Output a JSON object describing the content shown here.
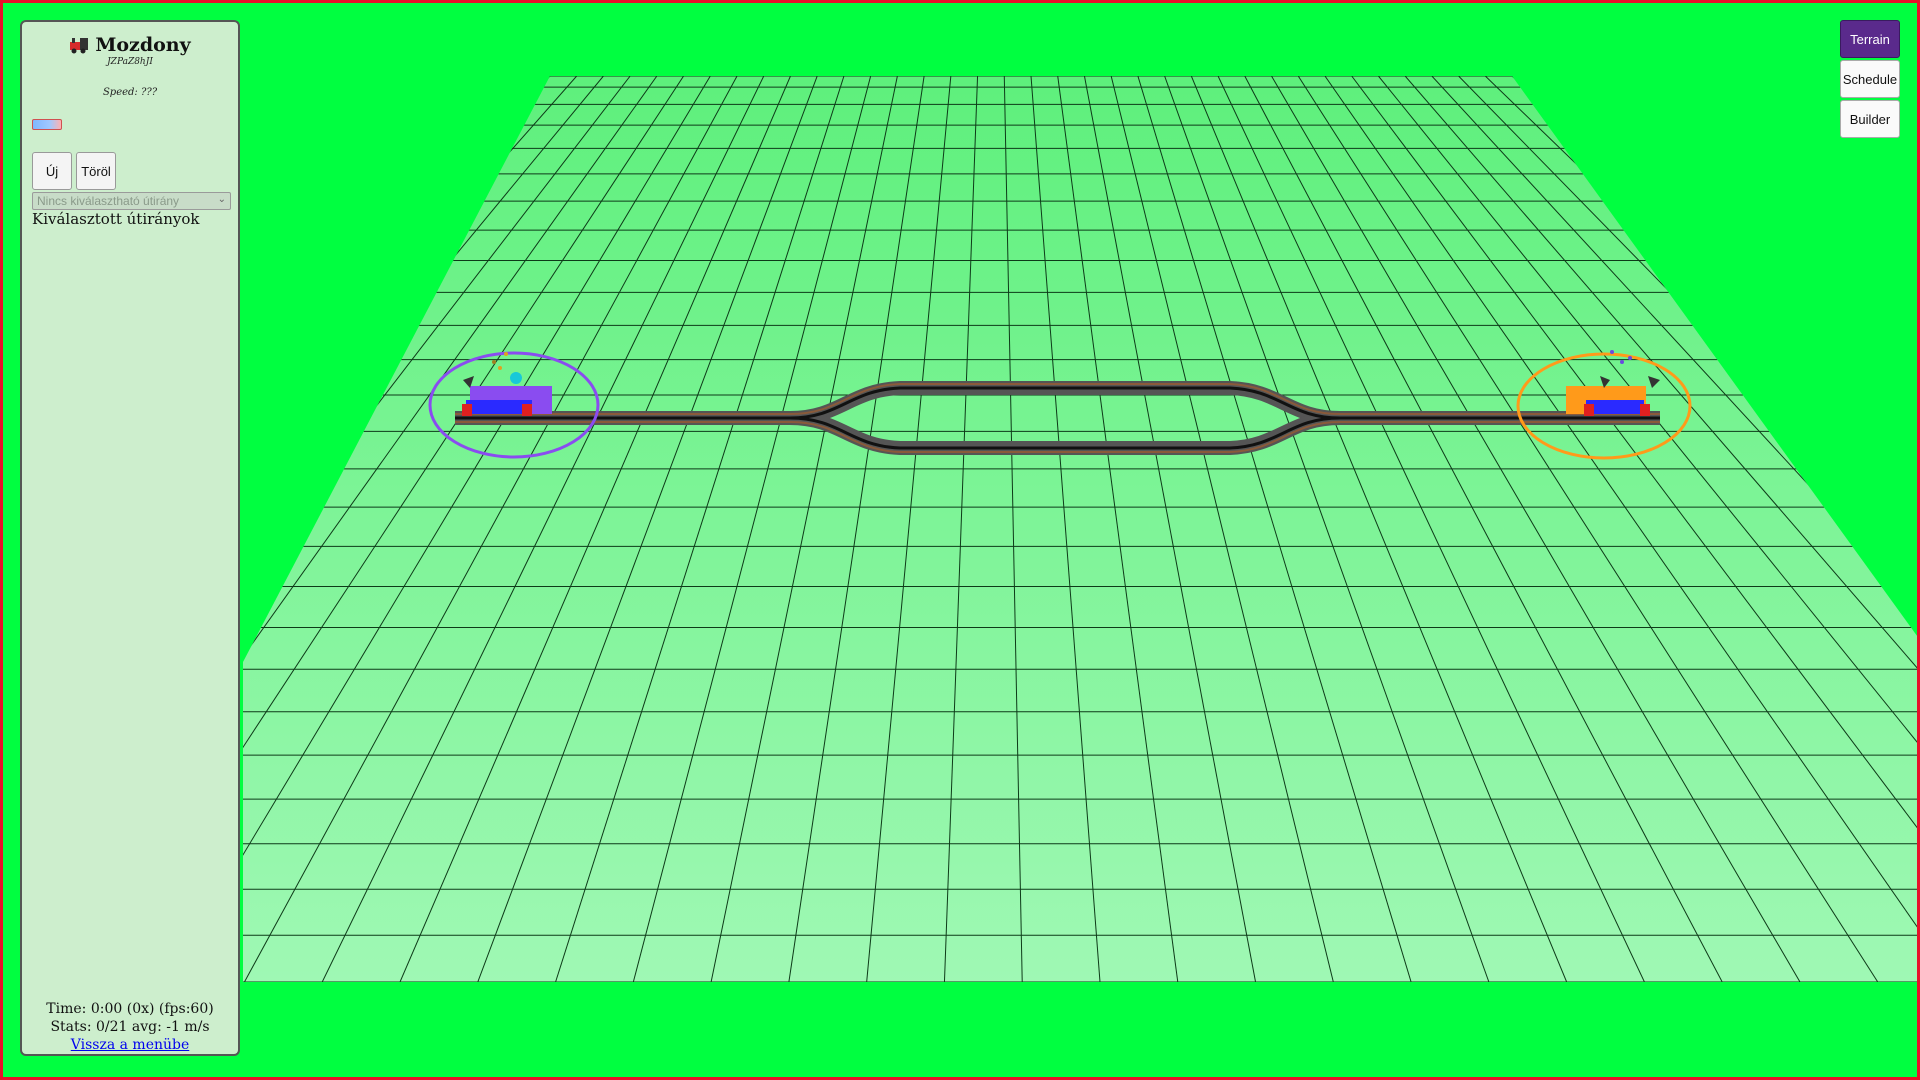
{
  "sidebar": {
    "title": "Mozdony",
    "user_id": "JZPaZ8hJI",
    "speed_label": "Speed: ???",
    "speed_fill": 0.6,
    "new_button": "Új",
    "delete_button": "Töröl",
    "route_select_placeholder": "Nincs kiválasztható útirány",
    "selected_routes_label": "Kiválasztott útirányok",
    "time_text": "Time: 0:00 (0x) (fps:60)",
    "stats_text": "Stats: 0/21 avg: -1 m/s",
    "back_link": "Vissza a menübe"
  },
  "tabs": [
    {
      "label": "Terrain",
      "active": true
    },
    {
      "label": "Schedule",
      "active": false
    },
    {
      "label": "Builder",
      "active": false
    }
  ],
  "colors": {
    "background": "#00ff40",
    "ground": "#7ef39a",
    "border": "#e8102a",
    "train_left_accent": "#8a4cf0",
    "train_right_accent": "#ff9a1a"
  },
  "icons": {
    "title_icon": "locomotive-icon"
  }
}
